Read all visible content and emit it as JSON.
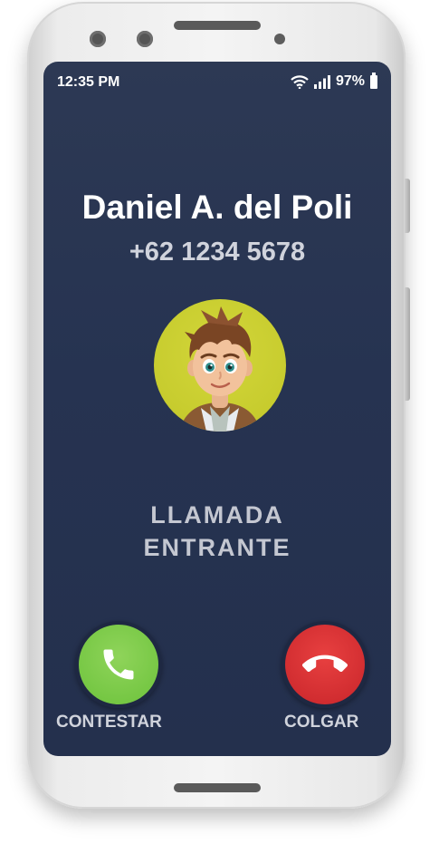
{
  "status_bar": {
    "time": "12:35 PM",
    "battery": "97%",
    "icons": [
      "wifi-icon",
      "signal-icon",
      "battery-icon"
    ]
  },
  "caller": {
    "name": "Daniel A. del Poli",
    "number": "+62 1234 5678",
    "avatar": "cartoon-boy-avatar"
  },
  "call_status": {
    "line1": "LLAMADA",
    "line2": "ENTRANTE"
  },
  "actions": {
    "answer_label": "CONTESTAR",
    "decline_label": "COLGAR",
    "answer_icon": "phone-icon",
    "decline_icon": "hang-up-icon"
  },
  "colors": {
    "screen_bg": "#263351",
    "answer": "#6cc23b",
    "decline": "#c8252a",
    "avatar_bg": "#c7cc2e"
  }
}
